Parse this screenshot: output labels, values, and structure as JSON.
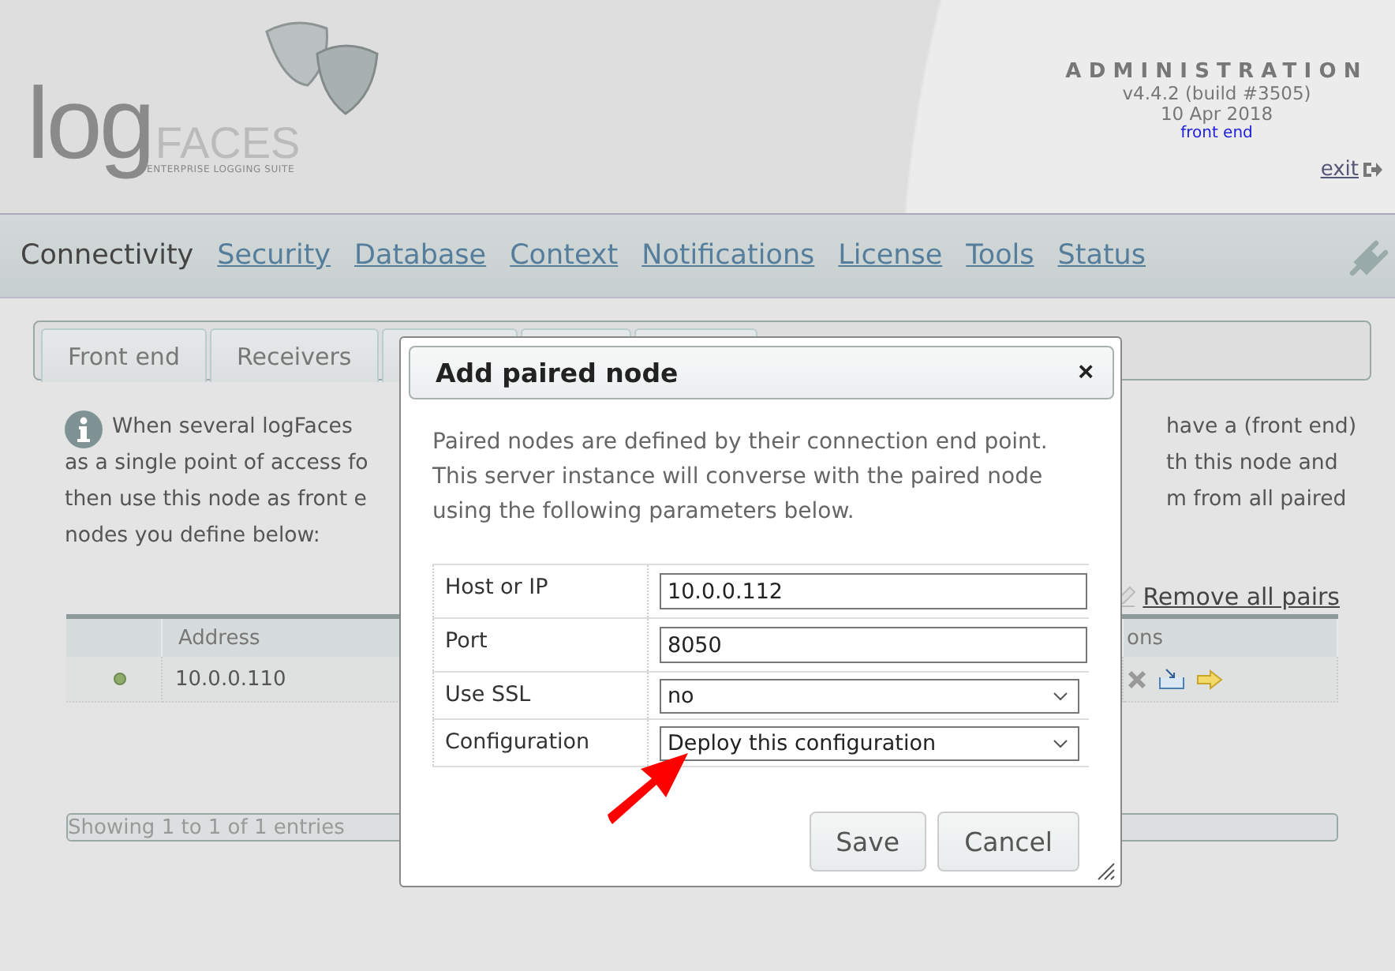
{
  "header": {
    "logo_main": "log",
    "logo_accent": "FACES",
    "tagline": "ENTERPRISE LOGGING SUITE",
    "title": "ADMINISTRATION",
    "version": "v4.4.2 (build #3505)",
    "date": "10 Apr 2018",
    "node_link": "front end",
    "exit_link": "exit"
  },
  "nav": [
    {
      "label": "Connectivity",
      "selected": true
    },
    {
      "label": "Security",
      "selected": false
    },
    {
      "label": "Database",
      "selected": false
    },
    {
      "label": "Context",
      "selected": false
    },
    {
      "label": "Notifications",
      "selected": false
    },
    {
      "label": "License",
      "selected": false
    },
    {
      "label": "Tools",
      "selected": false
    },
    {
      "label": "Status",
      "selected": false
    }
  ],
  "tabs": [
    {
      "label": "Front end"
    },
    {
      "label": "Receivers"
    }
  ],
  "intro": {
    "left_lines": [
      "When several logFaces",
      "as a single point of access fo",
      "then use this node as front e",
      "nodes you define below:"
    ],
    "right_lines": [
      "have a (front end)",
      "th this node and",
      "m from all paired"
    ]
  },
  "remove_all_link": "Remove all pairs",
  "table": {
    "columns": [
      "Address",
      "ons"
    ],
    "rows": [
      {
        "color": "#8fac6a",
        "address": "10.0.0.110"
      }
    ],
    "footer": "Showing 1 to 1 of 1 entries"
  },
  "dialog": {
    "title": "Add paired node",
    "close": "×",
    "description": [
      "Paired nodes are defined by their connection end point.",
      "This server instance will converse with the paired node",
      "using the following parameters below."
    ],
    "fields": [
      {
        "label": "Host or IP",
        "kind": "input",
        "value": "10.0.0.112"
      },
      {
        "label": "Port",
        "kind": "input",
        "value": "8050"
      },
      {
        "label": "Use SSL",
        "kind": "select",
        "value": "no"
      },
      {
        "label": "Configuration",
        "kind": "select",
        "value": "Deploy this configuration"
      }
    ],
    "buttons": [
      "Save",
      "Cancel"
    ]
  }
}
